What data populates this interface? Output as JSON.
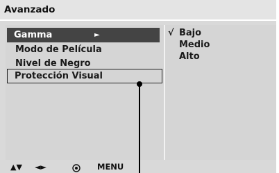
{
  "osd": {
    "title": "Avanzado",
    "menu_items": [
      {
        "label": "Gamma",
        "arrow": "►"
      },
      {
        "label": "Modo de Película"
      },
      {
        "label": "Nivel de Negro"
      },
      {
        "label": "Protección Visual"
      }
    ],
    "options": [
      {
        "label": "Bajo",
        "checked": true,
        "check_mark": "√"
      },
      {
        "label": "Medio",
        "checked": false
      },
      {
        "label": "Alto",
        "checked": false
      }
    ],
    "bottom_bar": {
      "nav_updown": "▲▼",
      "nav_leftright": "◄►",
      "menu_label": "MENU"
    },
    "colors": {
      "selected_bg": "#444444",
      "panel_bg": "#d5d5d5",
      "text": "#1a1a1a"
    }
  }
}
